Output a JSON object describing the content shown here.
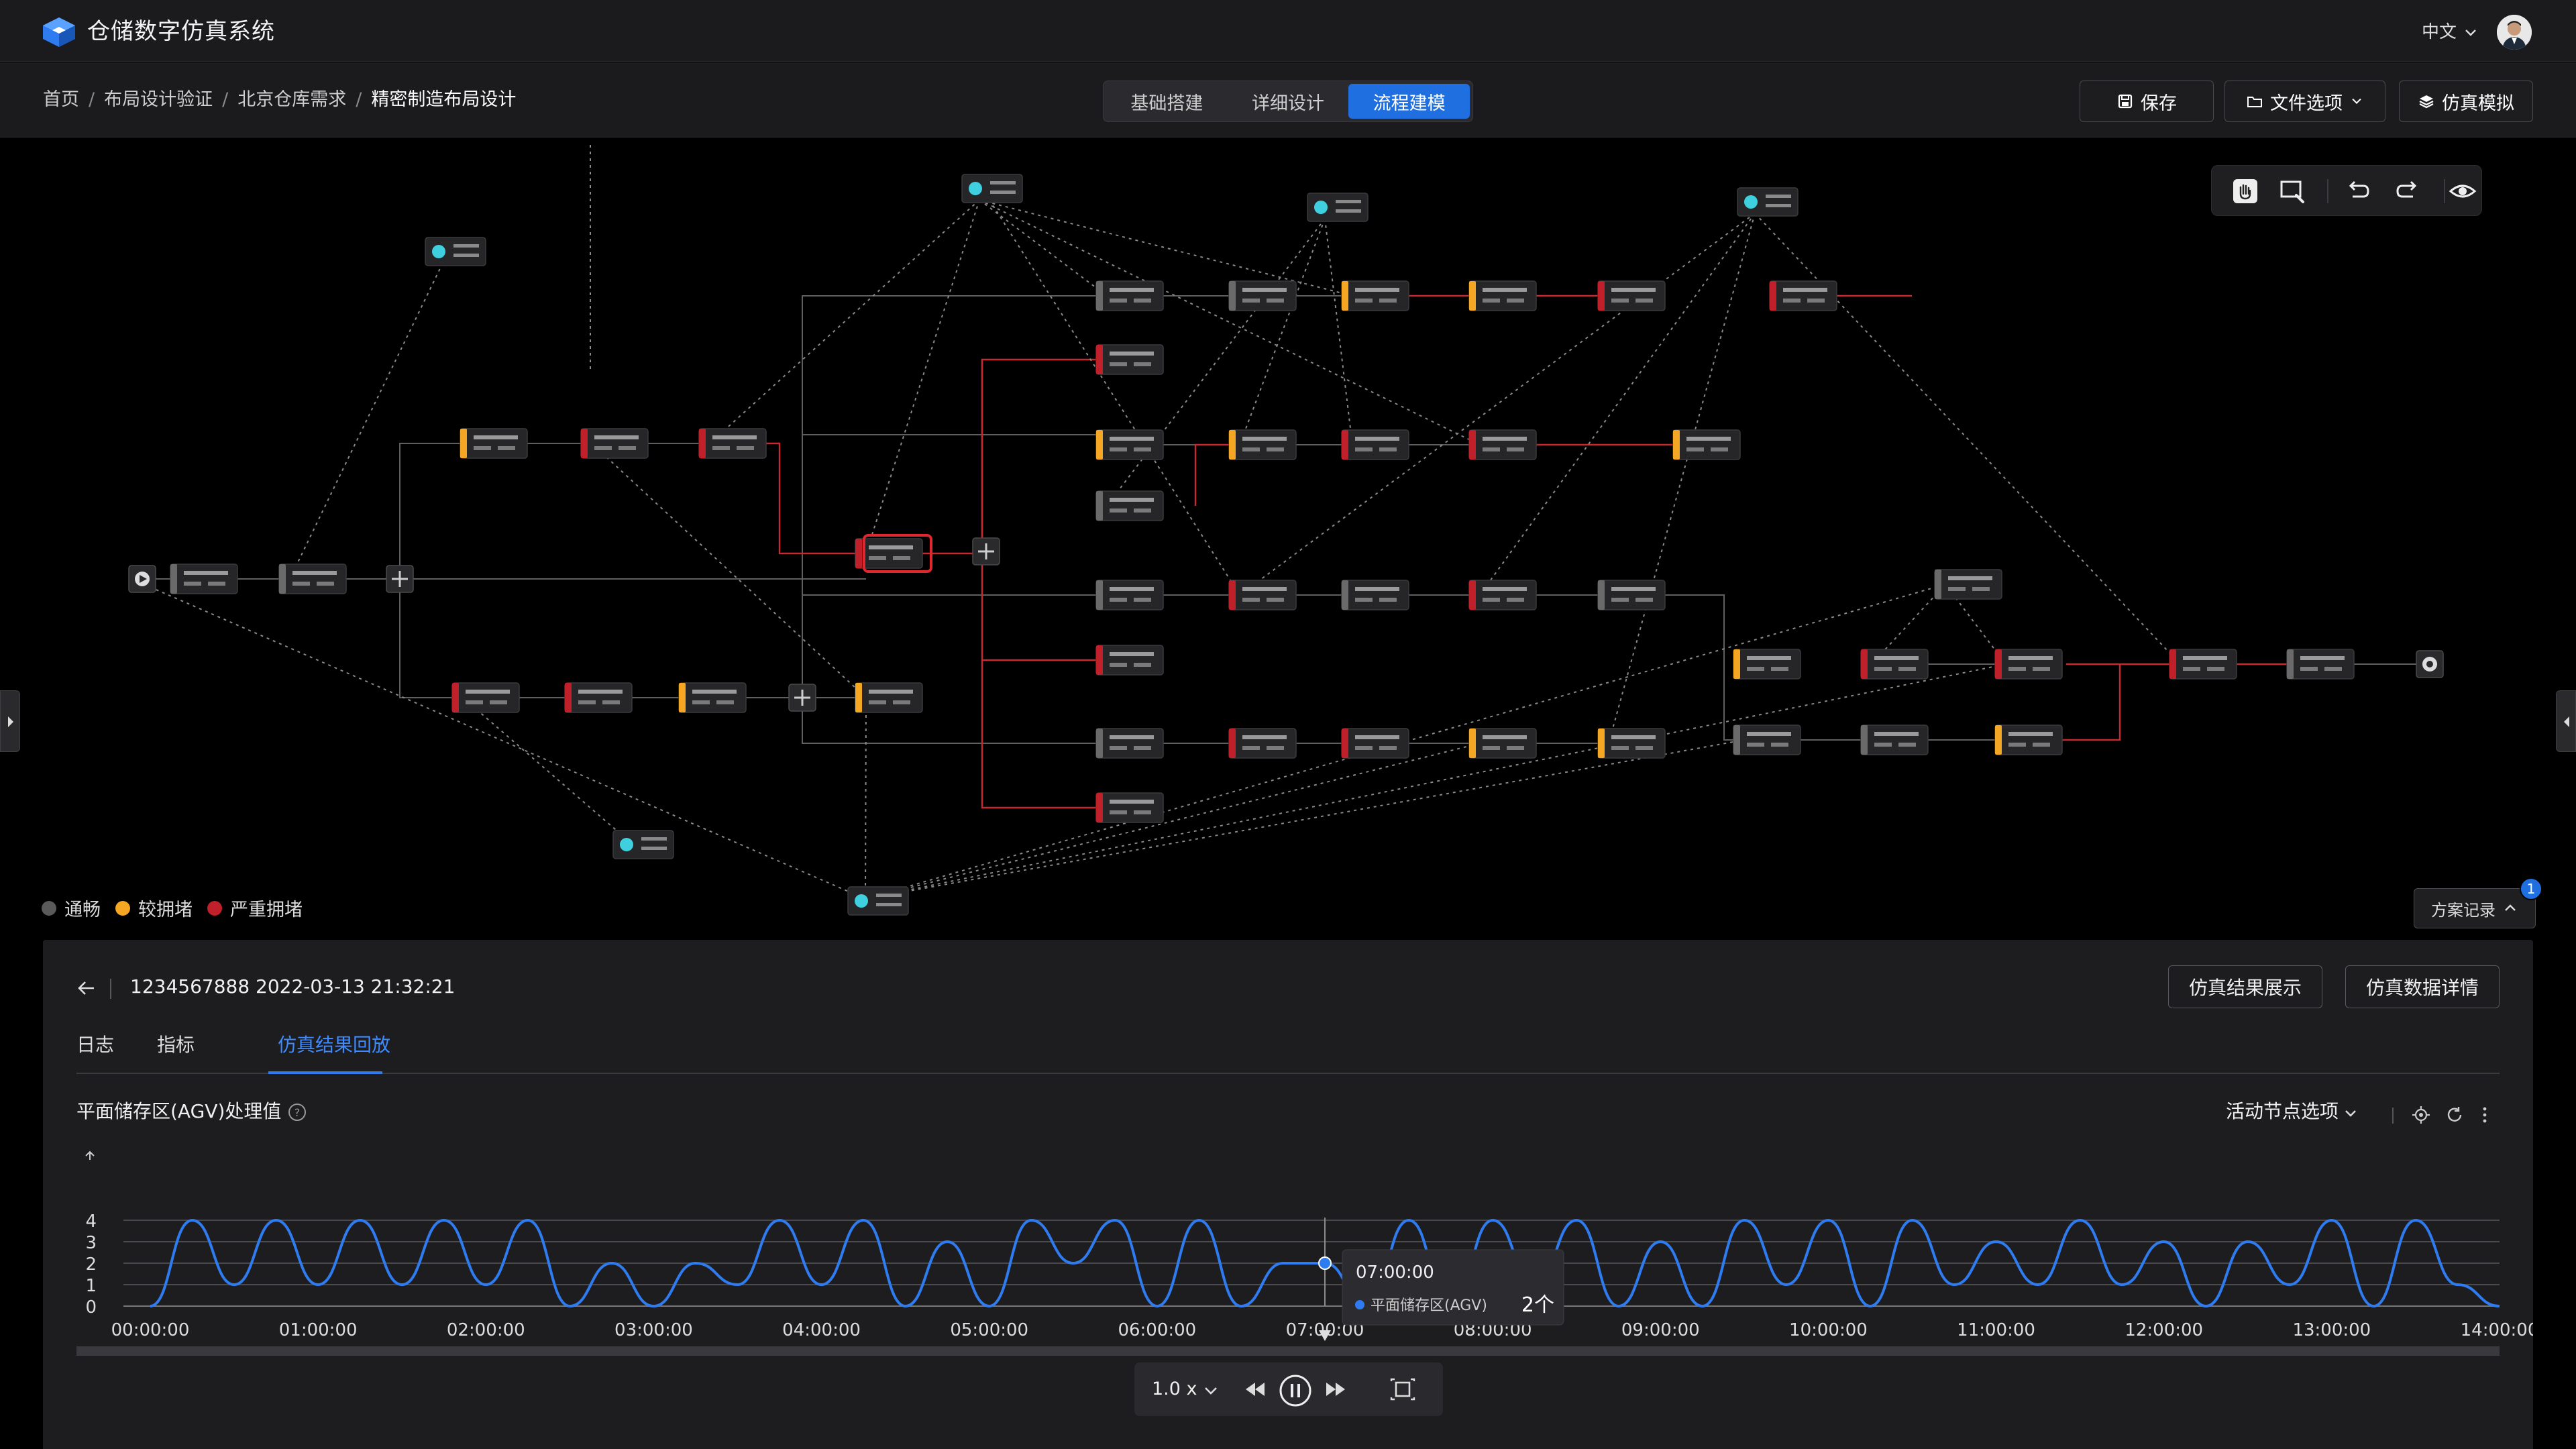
{
  "app": {
    "title": "仓储数字仿真系统",
    "language": "中文"
  },
  "breadcrumb": [
    "首页",
    "布局设计验证",
    "北京仓库需求",
    "精密制造布局设计"
  ],
  "mode_tabs": [
    {
      "label": "基础搭建",
      "active": false
    },
    {
      "label": "详细设计",
      "active": false
    },
    {
      "label": "流程建模",
      "active": true
    }
  ],
  "toolbar": {
    "save_label": "保存",
    "file_label": "文件选项",
    "simulate_label": "仿真模拟"
  },
  "legend": [
    {
      "label": "通畅",
      "color": "#5a5a5a"
    },
    {
      "label": "较拥堵",
      "color": "#f5a623"
    },
    {
      "label": "严重拥堵",
      "color": "#c0202a"
    }
  ],
  "plan_record": {
    "label": "方案记录",
    "badge": "1"
  },
  "panel": {
    "run_title": "1234567888 2022-03-13 21:32:21",
    "result_show_btn": "仿真结果展示",
    "data_detail_btn": "仿真数据详情",
    "tabs": [
      {
        "label": "日志",
        "active": false
      },
      {
        "label": "指标",
        "active": false
      },
      {
        "label": "仿真结果回放",
        "active": true
      }
    ],
    "chart_title": "平面储存区(AGV)处理值",
    "node_select": "活动节点选项",
    "speed": "1.0 x"
  },
  "chart_data": {
    "type": "line",
    "title": "平面储存区(AGV)处理值",
    "xlabel": "",
    "ylabel": "",
    "ylim": [
      0,
      4
    ],
    "yticks": [
      "0",
      "1",
      "2",
      "3",
      "4"
    ],
    "xticks": [
      "00:00:00",
      "01:00:00",
      "02:00:00",
      "03:00:00",
      "04:00:00",
      "05:00:00",
      "06:00:00",
      "07:00:00",
      "08:00:00",
      "09:00:00",
      "10:00:00",
      "11:00:00",
      "12:00:00",
      "13:00:00",
      "14:00:00"
    ],
    "grid": true,
    "series": [
      {
        "name": "平面储存区(AGV)",
        "color": "#2f7bf0",
        "x": [
          0.0,
          0.25,
          0.5,
          0.75,
          1.0,
          1.25,
          1.5,
          1.75,
          2.0,
          2.25,
          2.5,
          2.75,
          3.0,
          3.25,
          3.5,
          3.75,
          4.0,
          4.25,
          4.5,
          4.75,
          5.0,
          5.25,
          5.5,
          5.75,
          6.0,
          6.25,
          6.5,
          6.75,
          7.0,
          7.25,
          7.5,
          7.75,
          8.0,
          8.25,
          8.5,
          8.75,
          9.0,
          9.25,
          9.5,
          9.75,
          10.0,
          10.25,
          10.5,
          10.75,
          11.0,
          11.25,
          11.5,
          11.75,
          12.0,
          12.25,
          12.5,
          12.75,
          13.0,
          13.25,
          13.5,
          13.75,
          14.0
        ],
        "values": [
          0,
          4,
          1,
          4,
          1,
          4,
          1,
          4,
          1,
          4,
          0,
          2,
          0,
          2,
          1,
          4,
          1,
          4,
          0,
          3,
          0,
          4,
          2,
          4,
          0,
          4,
          0,
          2,
          2,
          0,
          4,
          0,
          4,
          1,
          4,
          0,
          3,
          0,
          4,
          1,
          4,
          0,
          4,
          1,
          3,
          1,
          4,
          1,
          3,
          0,
          3,
          1,
          4,
          0,
          4,
          1,
          0
        ]
      }
    ],
    "tooltip": {
      "time": "07:00:00",
      "series": "平面储存区(AGV)",
      "value": "2个"
    }
  }
}
